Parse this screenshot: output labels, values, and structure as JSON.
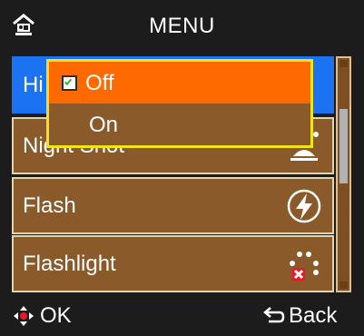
{
  "header": {
    "title": "MENU",
    "icon": "camera-scene-icon"
  },
  "menu": {
    "items": [
      {
        "label": "Hi",
        "icon": "",
        "selected": true
      },
      {
        "label": "Night Shot",
        "icon": "night-portrait-icon",
        "selected": false
      },
      {
        "label": "Flash",
        "icon": "flash-auto-icon",
        "selected": false
      },
      {
        "label": "Flashlight",
        "icon": "flashlight-off-icon",
        "selected": false
      }
    ]
  },
  "dropdown": {
    "options": [
      {
        "label": "Off",
        "checked": true
      },
      {
        "label": "On",
        "checked": false
      }
    ]
  },
  "footer": {
    "ok_label": "OK",
    "ok_icon": "dpad-icon",
    "back_label": "Back",
    "back_icon": "back-arrow-icon"
  },
  "colors": {
    "background": "#1c1c1c",
    "item_brown": "#8b5a2b",
    "item_border": "#e9d2a3",
    "selected_blue": "#1b73f1",
    "highlight_orange": "#ff6a00",
    "dropdown_border": "#f2e21a"
  }
}
